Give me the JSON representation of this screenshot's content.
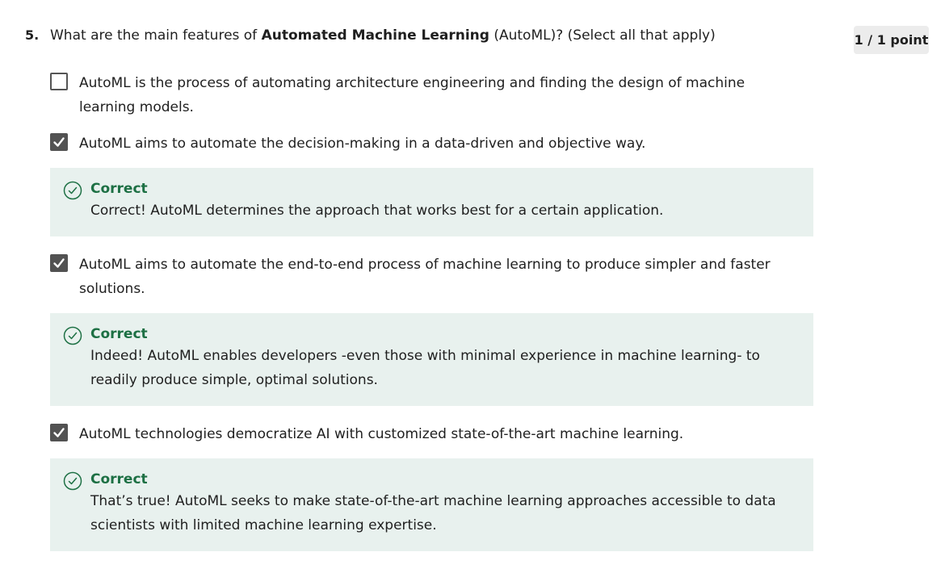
{
  "question": {
    "number": "5.",
    "text_before": "What are the main features of ",
    "text_bold": "Automated Machine Learning",
    "text_after": " (AutoML)? (Select all that apply)",
    "points": "1 / 1 point"
  },
  "options": [
    {
      "label": "AutoML is the process of automating architecture engineering and finding the design of machine learning models.",
      "checked": false
    },
    {
      "label": "AutoML aims to automate the decision-making in a data-driven and objective way.",
      "checked": true
    },
    {
      "label": "AutoML aims to automate the end-to-end process of machine learning to produce simpler and faster solutions.",
      "checked": true
    },
    {
      "label": "AutoML technologies democratize AI with customized state-of-the-art machine learning.",
      "checked": true
    }
  ],
  "feedback": [
    {
      "title": "Correct",
      "text": "Correct! AutoML determines the approach that works best for a certain application."
    },
    {
      "title": "Correct",
      "text": "Indeed! AutoML enables developers -even those with minimal experience in machine learning- to readily produce simple, optimal solutions."
    },
    {
      "title": "Correct",
      "text": "That’s true! AutoML seeks to make state-of-the-art machine learning approaches accessible to data scientists with limited machine learning expertise."
    }
  ],
  "colors": {
    "correct": "#1d7044",
    "feedback_bg": "#e8f1ee",
    "checkbox_checked": "#525252"
  },
  "icons": {
    "checkbox_checked": "check-icon",
    "feedback": "check-circle-icon"
  }
}
